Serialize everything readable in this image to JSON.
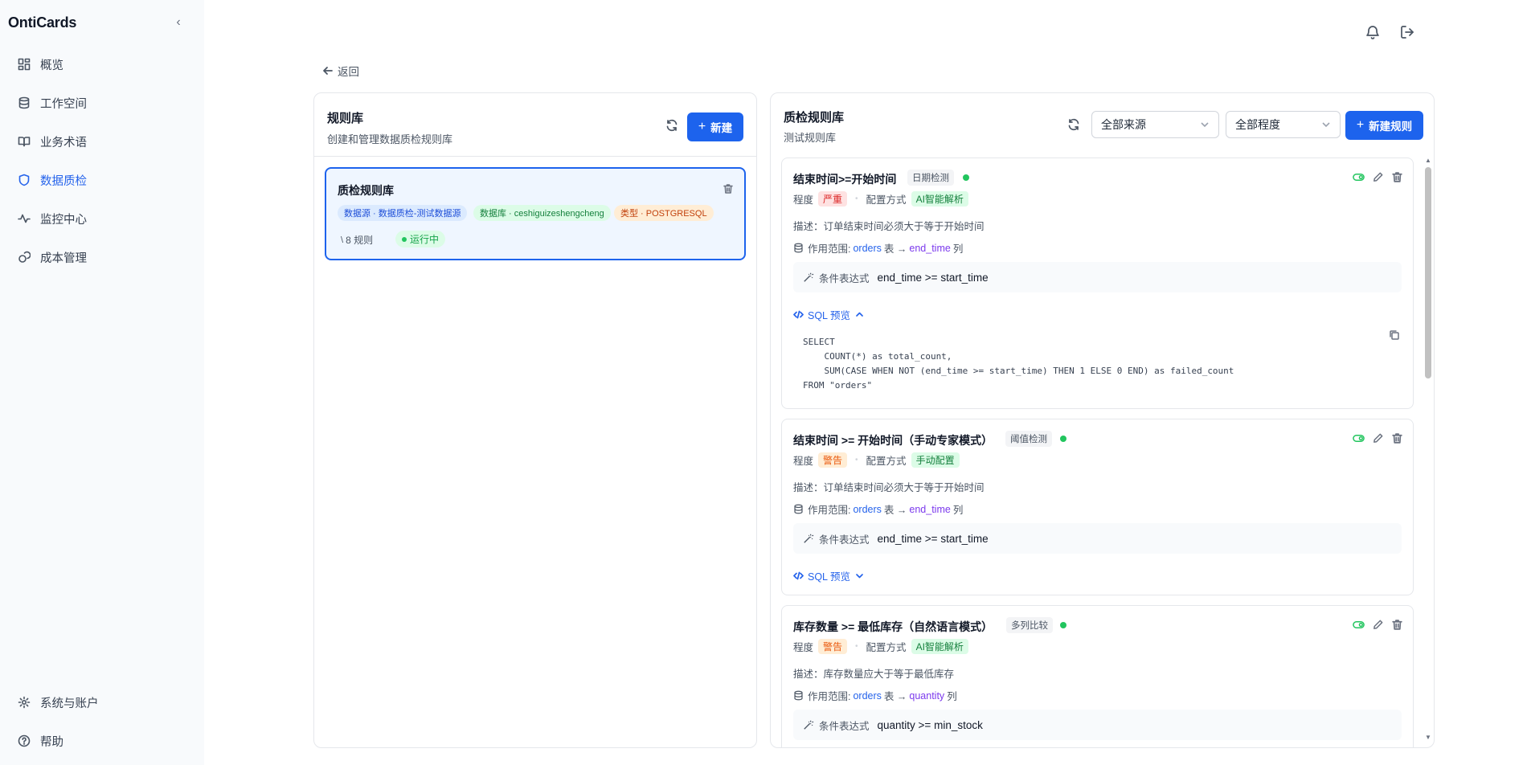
{
  "app": {
    "brand": "OntiCards"
  },
  "sidebar": {
    "items": [
      {
        "label": "概览",
        "icon": "dashboard-icon"
      },
      {
        "label": "工作空间",
        "icon": "database-icon"
      },
      {
        "label": "业务术语",
        "icon": "book-icon"
      },
      {
        "label": "数据质检",
        "icon": "shield-icon",
        "active": true
      },
      {
        "label": "监控中心",
        "icon": "activity-icon"
      },
      {
        "label": "成本管理",
        "icon": "coins-icon"
      }
    ],
    "bottom": [
      {
        "label": "系统与账户",
        "icon": "gear-icon"
      },
      {
        "label": "帮助",
        "icon": "help-icon"
      }
    ]
  },
  "header": {
    "back_label": "返回"
  },
  "library_panel": {
    "title": "规则库",
    "subtitle": "创建和管理数据质检规则库",
    "new_button": "新建",
    "card": {
      "title": "质检规则库",
      "tags": [
        "数据源 · 数据质检-测试数据源",
        "数据库 · ceshiguizeshengcheng",
        "类型 · POSTGRESQL"
      ],
      "rule_count": "8 规则",
      "status": "运行中"
    }
  },
  "rules_panel": {
    "title": "质检规则库",
    "subtitle": "测试规则库",
    "source_filter": "全部来源",
    "severity_filter": "全部程度",
    "new_button": "新建规则",
    "labels": {
      "severity": "程度",
      "config": "配置方式",
      "scope": "作用范围:",
      "table_word": "表 →",
      "column_word": "列",
      "condition": "条件表达式",
      "sql_preview": "SQL 预览"
    },
    "rules": [
      {
        "title": "结束时间>=开始时间",
        "type": "日期检测",
        "severity": "严重",
        "config": "AI智能解析",
        "description": "描述：订单结束时间必须大于等于开始时间",
        "table": "orders",
        "column": "end_time",
        "condition": "end_time >= start_time",
        "sql": "SELECT\n    COUNT(*) as total_count,\n    SUM(CASE WHEN NOT (end_time >= start_time) THEN 1 ELSE 0 END) as failed_count\nFROM \"orders\""
      },
      {
        "title": "结束时间 >= 开始时间（手动专家模式）",
        "type": "阈值检测",
        "severity": "警告",
        "config": "手动配置",
        "description": "描述：订单结束时间必须大于等于开始时间",
        "table": "orders",
        "column": "end_time",
        "condition": "end_time >= start_time"
      },
      {
        "title": "库存数量 >= 最低库存（自然语言模式）",
        "type": "多列比较",
        "severity": "警告",
        "config": "AI智能解析",
        "description": "描述：库存数量应大于等于最低库存",
        "table": "orders",
        "column": "quantity",
        "condition": "quantity >= min_stock"
      }
    ]
  }
}
